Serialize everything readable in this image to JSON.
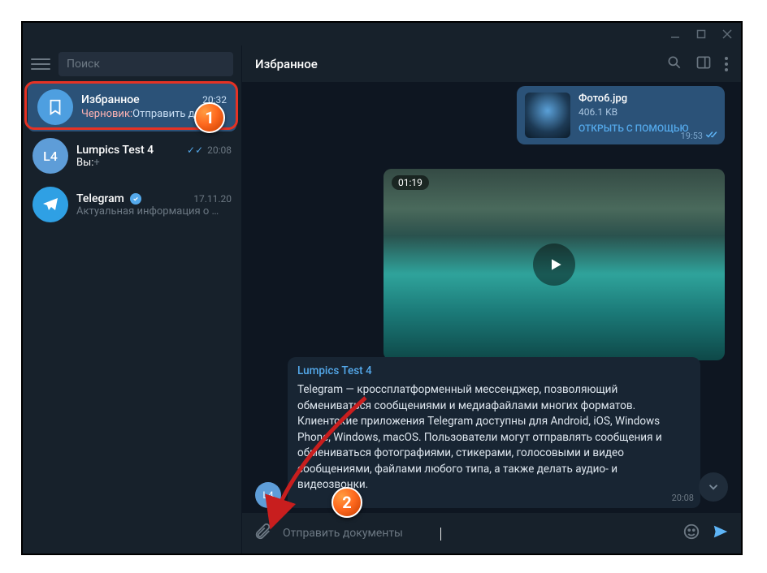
{
  "window": {
    "minimize": "min",
    "maximize": "max",
    "close": "close"
  },
  "sidebar": {
    "search_placeholder": "Поиск",
    "items": [
      {
        "name": "Избранное",
        "time": "20:32",
        "draft_label": "Черновик:",
        "draft_text": " Отправить д…",
        "pinned": true,
        "avatar_bg": "#4e9fe0"
      },
      {
        "name": "Lumpics Test 4",
        "time": "20:08",
        "you_label": "Вы:",
        "you_text": " +",
        "read": true,
        "avatar_initials": "L4",
        "avatar_bg": "#5e9dd8"
      },
      {
        "name": "Telegram",
        "verified": true,
        "time": "17.11.20",
        "preview": "Актуальная информация о …",
        "avatar_bg": "#2fa0e4"
      }
    ]
  },
  "header": {
    "title": "Избранное"
  },
  "messages": {
    "file": {
      "name": "Фото6.jpg",
      "size": "406.1 KB",
      "open_with": "ОТКРЫТЬ С ПОМОЩЬЮ",
      "time": "19:53"
    },
    "video": {
      "duration": "01:19"
    },
    "quote": {
      "from": "Lumpics Test 4",
      "text": "Telegram — кроссплатформенный мессенджер, позволяющий обмениваться сообщениями и медиафайлами многих форматов. Клиентские приложения Telegram доступны для Android, iOS, Windows Phone, Windows, macOS. Пользователи могут отправлять сообщения и обмениваться фотографиями, стикерами, голосовыми и видео сообщениями, файлами любого типа, а также делать аудио- и видеозвонки.",
      "avatar": "L4",
      "time": "20:08"
    }
  },
  "compose": {
    "placeholder": "Отправить документы"
  },
  "markers": {
    "m1": "1",
    "m2": "2"
  }
}
